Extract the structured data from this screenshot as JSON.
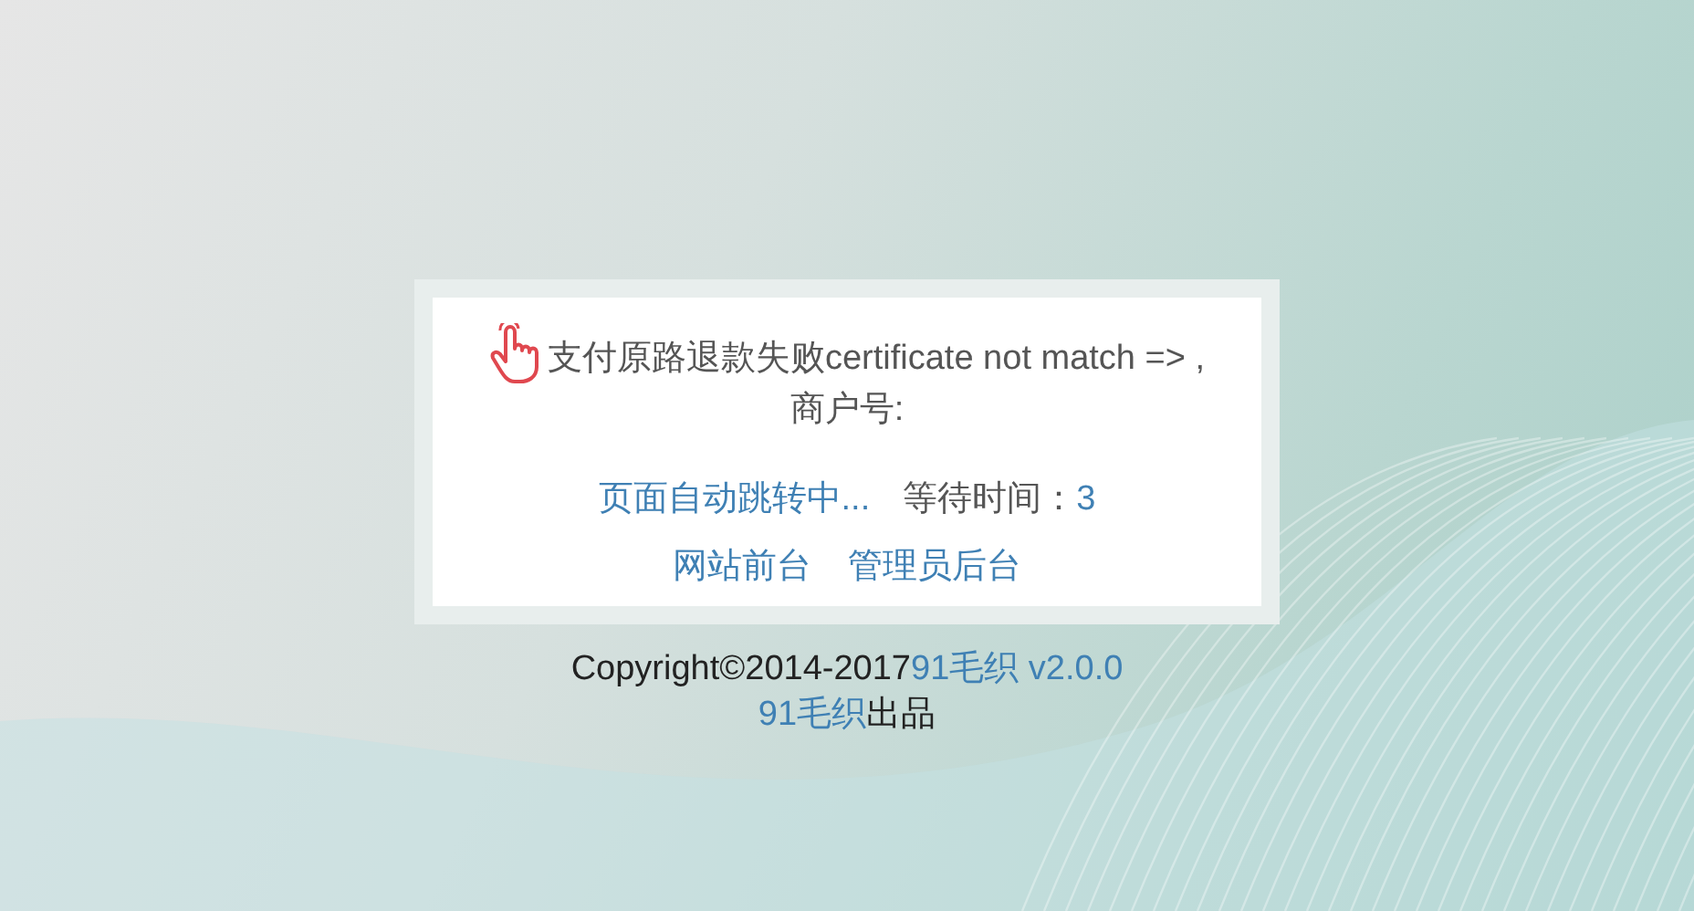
{
  "message": {
    "line_1": "支付原路退款失败certificate not match => ,",
    "line_2": "商户号:"
  },
  "redirect": {
    "link": "页面自动跳转中...",
    "wait_label": "等待时间：",
    "wait_value": "3"
  },
  "links": [
    "网站前台",
    "管理员后台"
  ],
  "footer": {
    "copyright": "Copyright©2014-2017",
    "brand": "91毛织 v2.0.0",
    "brand_2": "91毛织",
    "suffix": "出品"
  }
}
